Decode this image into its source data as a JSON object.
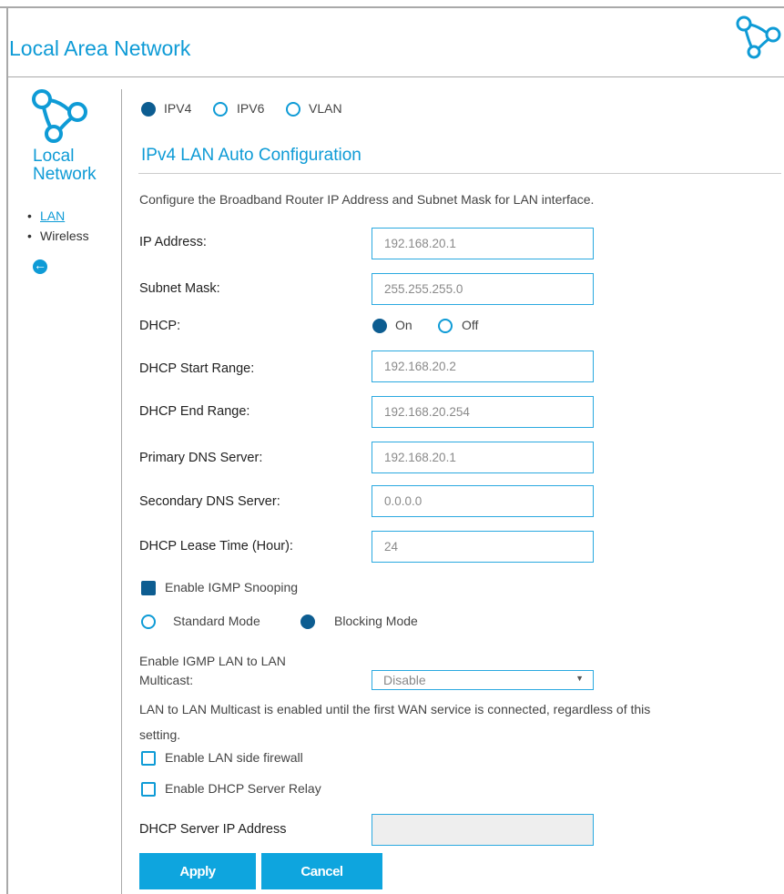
{
  "header": {
    "title": "Local Area Network",
    "icon": "network-nodes-icon"
  },
  "sidebar": {
    "title_line1": "Local",
    "title_line2": "Network",
    "items": [
      {
        "label": "LAN",
        "active": true
      },
      {
        "label": "Wireless",
        "active": false
      }
    ],
    "back_icon": "back-arrow-icon"
  },
  "ip_version": {
    "options": [
      "IPV4",
      "IPV6",
      "VLAN"
    ],
    "selected": "IPV4"
  },
  "section": {
    "title": "IPv4 LAN Auto Configuration",
    "description": "Configure the Broadband Router IP Address and Subnet Mask for LAN interface."
  },
  "fields": {
    "ip_address": {
      "label": "IP Address:",
      "value": "192.168.20.1"
    },
    "subnet_mask": {
      "label": "Subnet Mask:",
      "value": "255.255.255.0"
    },
    "dhcp": {
      "label": "DHCP:",
      "on_label": "On",
      "off_label": "Off",
      "selected": "On"
    },
    "dhcp_start": {
      "label": "DHCP Start Range:",
      "value": "192.168.20.2"
    },
    "dhcp_end": {
      "label": "DHCP End Range:",
      "value": "192.168.20.254"
    },
    "primary_dns": {
      "label": "Primary DNS Server:",
      "value": "192.168.20.1"
    },
    "secondary_dns": {
      "label": "Secondary DNS Server:",
      "value": "0.0.0.0"
    },
    "lease_time": {
      "label": "DHCP Lease Time (Hour):",
      "value": "24"
    }
  },
  "igmp": {
    "snooping_label": "Enable IGMP Snooping",
    "snooping_checked": true,
    "standard_mode": "Standard Mode",
    "blocking_mode": "Blocking Mode",
    "mode_selected": "Blocking Mode",
    "lan_multicast_label_line1": "Enable IGMP LAN to LAN",
    "lan_multicast_label_line2": "Multicast:",
    "lan_multicast_value": "Disable",
    "note_line1": "LAN to LAN Multicast is enabled until the first WAN service is connected, regardless of this",
    "note_line2": "setting."
  },
  "options": {
    "lan_firewall_label": "Enable LAN side firewall",
    "lan_firewall_checked": false,
    "dhcp_relay_label": "Enable DHCP Server Relay",
    "dhcp_relay_checked": false
  },
  "dhcp_server_ip": {
    "label": "DHCP Server IP Address",
    "value": ""
  },
  "buttons": {
    "apply": "Apply",
    "cancel": "Cancel"
  },
  "colors": {
    "accent": "#0e9bd6",
    "selected": "#0d5d91",
    "button": "#0ea5de"
  }
}
